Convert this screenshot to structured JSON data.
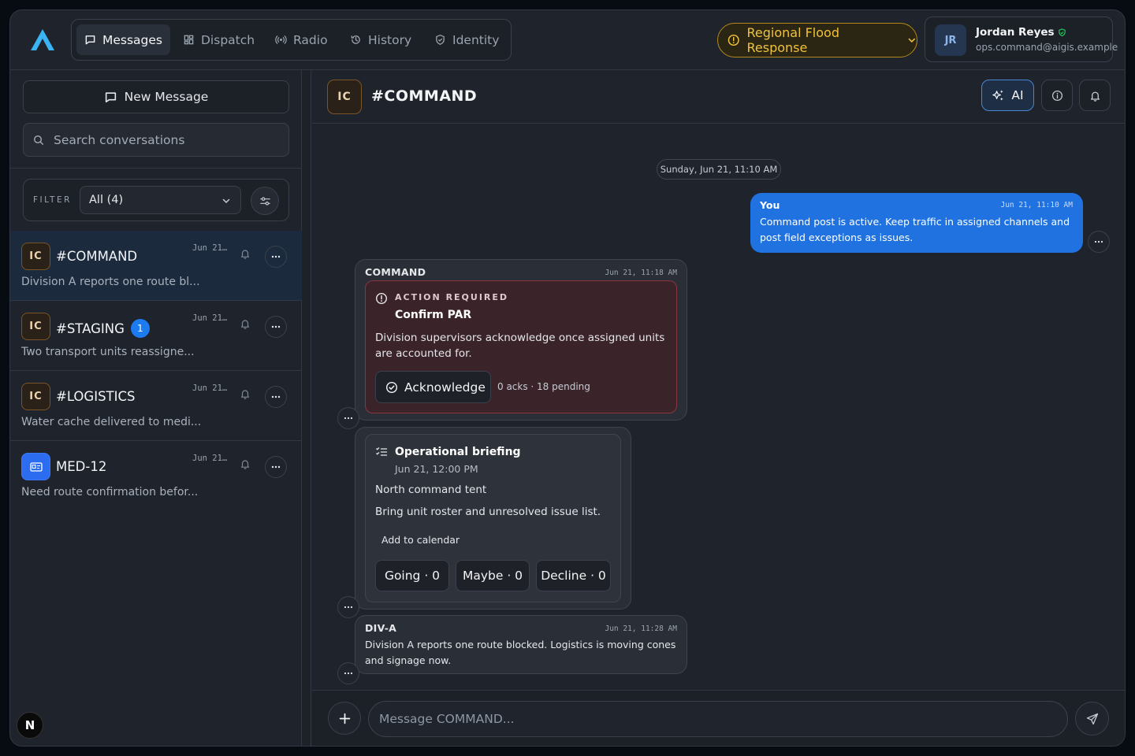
{
  "nav": {
    "tabs": [
      {
        "label": "Messages",
        "icon": "message-square-icon",
        "active": true
      },
      {
        "label": "Dispatch",
        "icon": "grid-icon"
      },
      {
        "label": "Radio",
        "icon": "radio-icon"
      },
      {
        "label": "History",
        "icon": "history-icon"
      },
      {
        "label": "Identity",
        "icon": "shield-icon"
      }
    ]
  },
  "incident": {
    "label": "Regional Flood Response",
    "color": "#f0c23c"
  },
  "user": {
    "initials": "JR",
    "name": "Jordan Reyes",
    "email": "ops.command@aigis.example"
  },
  "sidebar": {
    "new_message": "New Message",
    "search_placeholder": "Search conversations",
    "filter_label": "FILTER",
    "filter_value": "All (4)",
    "conversations": [
      {
        "icon": "IC",
        "name": "#COMMAND",
        "date": "Jun 21…",
        "preview": "Division A reports one route bl...",
        "active": true
      },
      {
        "icon": "IC",
        "name": "#STAGING",
        "badge": "1",
        "date": "Jun 21…",
        "preview": "Two transport units reassigne..."
      },
      {
        "icon": "IC",
        "name": "#LOGISTICS",
        "date": "Jun 21…",
        "preview": "Water cache delivered to medi..."
      },
      {
        "icon": "id-card-icon",
        "name": "MED-12",
        "date": "Jun 21…",
        "preview": "Need route confirmation befor..."
      }
    ],
    "dev_badge": "N"
  },
  "channel": {
    "icon": "IC",
    "title": "#COMMAND",
    "ai_label": "AI"
  },
  "messages": {
    "date_separator": "Sunday, Jun 21, 11:10 AM",
    "own": {
      "sender": "You",
      "time": "Jun 21, 11:10 AM",
      "text": "Command post is active. Keep traffic in assigned channels and post field exceptions as issues."
    },
    "action": {
      "sender": "COMMAND",
      "time": "Jun 21, 11:18 AM",
      "label": "ACTION REQUIRED",
      "title": "Confirm PAR",
      "body": "Division supervisors acknowledge once assigned units are accounted for.",
      "button": "Acknowledge",
      "status": "0 acks · 18 pending"
    },
    "event": {
      "title": "Operational briefing",
      "time": "Jun 21, 12:00 PM",
      "location": "North command tent",
      "note": "Bring unit roster and unresolved issue list.",
      "calendar": "Add to calendar",
      "going": "Going · 0",
      "maybe": "Maybe · 0",
      "decline": "Decline · 0"
    },
    "reply": {
      "sender": "DIV-A",
      "time": "Jun 21, 11:28 AM",
      "text": "Division A reports one route blocked. Logistics is moving cones and signage now."
    }
  },
  "composer": {
    "placeholder": "Message COMMAND..."
  }
}
